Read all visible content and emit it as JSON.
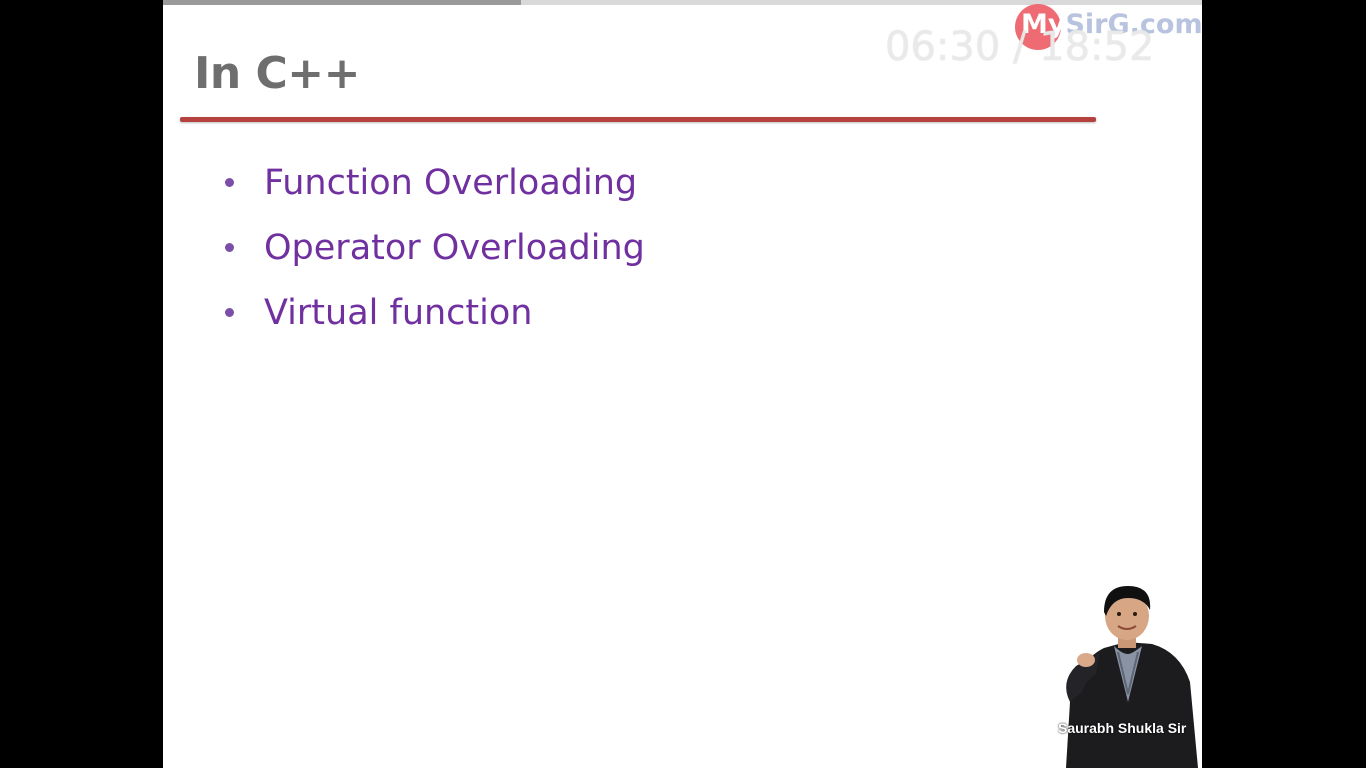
{
  "video": {
    "time_display": "06:30 / 18:52",
    "progress_fraction": 0.345,
    "watermark_brand_prefix": "My",
    "watermark_brand_rest": "SirG.com"
  },
  "slide": {
    "title": "In C++",
    "bullets": [
      "Function Overloading",
      "Operator Overloading",
      "Virtual function"
    ],
    "presenter_label": "Saurabh Shukla Sir"
  },
  "colors": {
    "title": "#6e6e6e",
    "rule": "#b5423f",
    "bullet_text": "#7030a0",
    "background": "#ffffff",
    "letterbox": "#000000"
  }
}
